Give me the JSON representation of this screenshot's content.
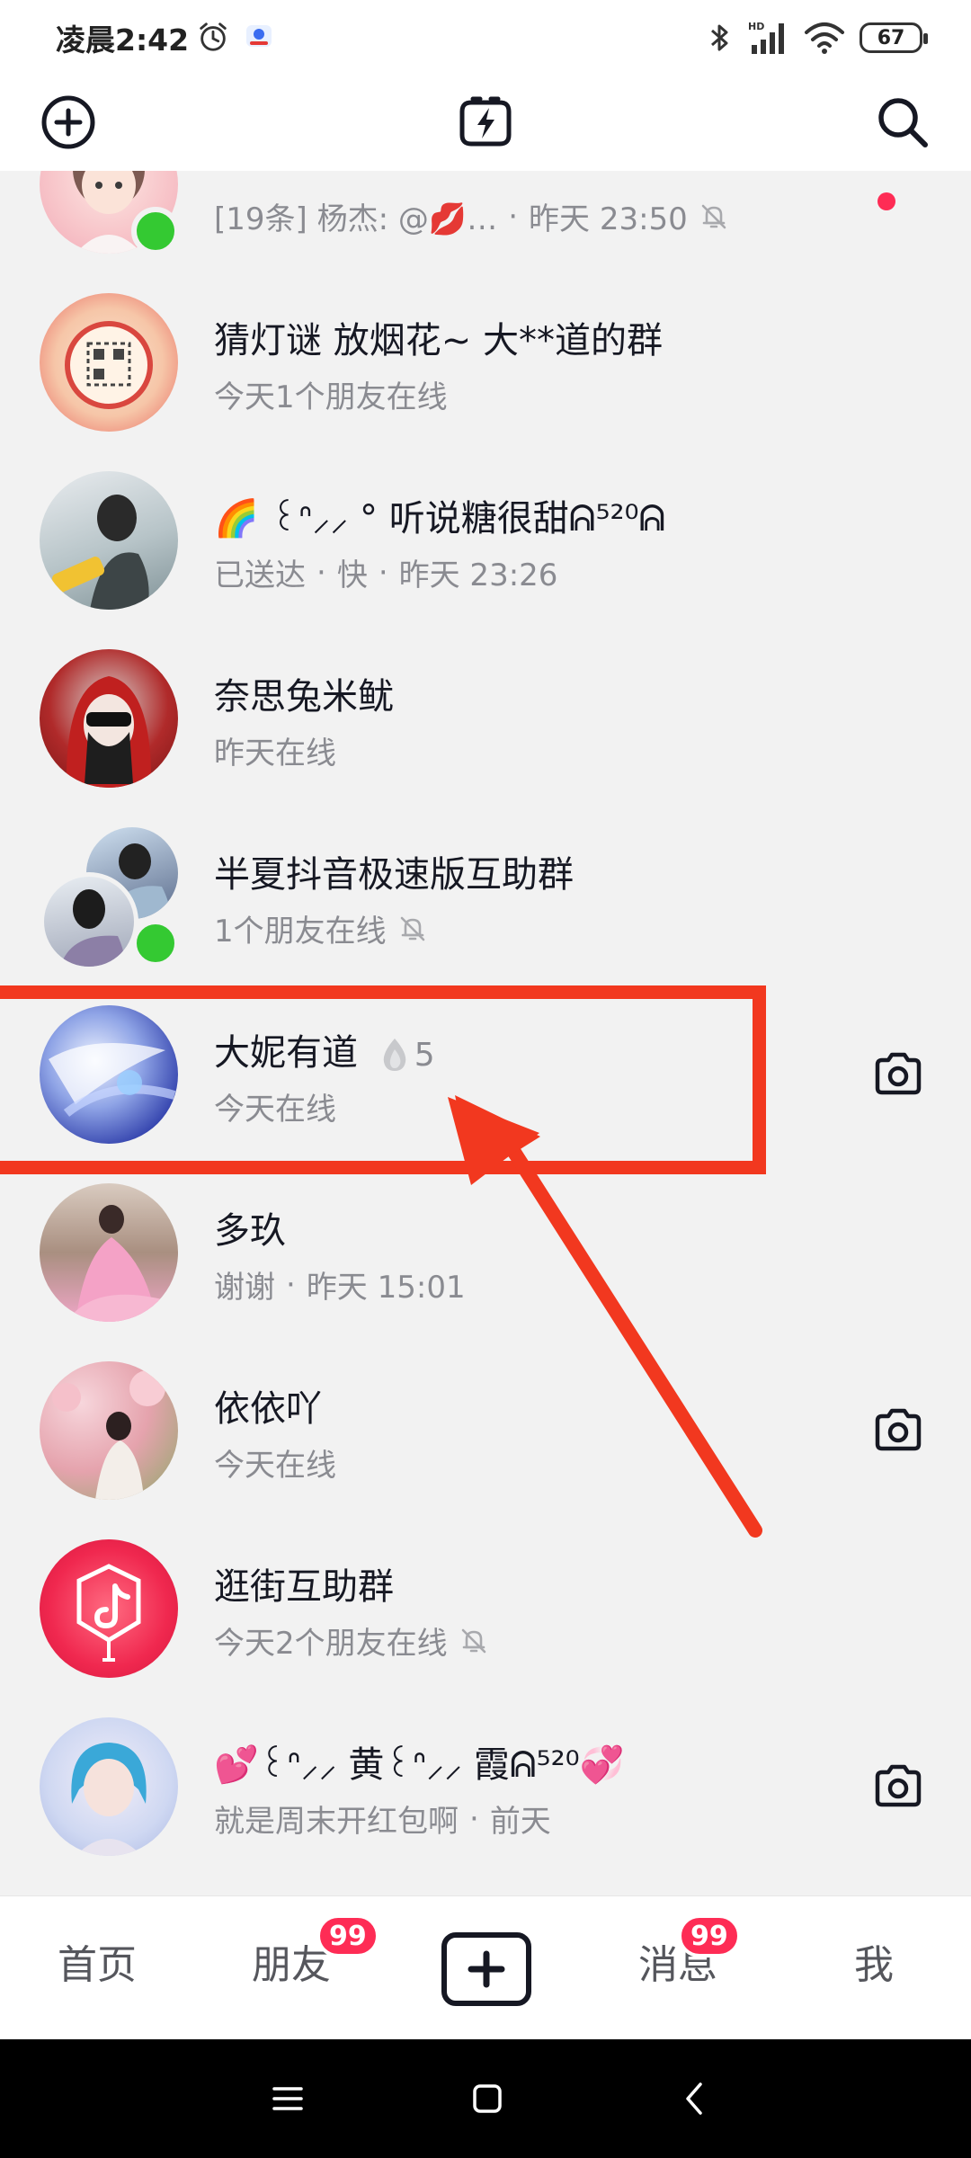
{
  "status_bar": {
    "time": "凌晨2:42",
    "battery": "67",
    "signal_label": "HD"
  },
  "top_nav": {
    "add_icon": "plus-circle-icon",
    "center_icon": "flash-chat-icon",
    "search_icon": "search-icon"
  },
  "chats": [
    {
      "name": "",
      "subtitle": "[19条] 杨杰: @💋…",
      "time": "昨天 23:50",
      "muted": true,
      "online": true,
      "unread_dot": true
    },
    {
      "name": "猜灯谜 放烟花~ 大**道的群",
      "subtitle": "今天1个朋友在线"
    },
    {
      "name": "🌈 ꒰ᐢ⸝⸝ ° 听说糖很甜ᕱ⁵²⁰ᕱ",
      "subtitle": "已送达",
      "subtitle2": "快",
      "time": "昨天 23:26"
    },
    {
      "name": "奈思兔米鱿",
      "subtitle": "昨天在线"
    },
    {
      "name": "半夏抖音极速版互助群",
      "subtitle": "1个朋友在线",
      "muted": true,
      "online": true
    },
    {
      "name": "大妮有道",
      "spark_count": "5",
      "subtitle": "今天在线",
      "camera": true
    },
    {
      "name": "多玖",
      "subtitle": "谢谢",
      "time": "昨天 15:01"
    },
    {
      "name": "依依吖",
      "subtitle": "今天在线",
      "camera": true
    },
    {
      "name": "逛街互助群",
      "subtitle": "今天2个朋友在线",
      "muted": true
    },
    {
      "name": "💕꒰ᐢ⸝⸝ 黄꒰ᐢ⸝⸝ 霞ᕱ⁵²⁰💞",
      "subtitle": "就是周末开红包啊",
      "time": "前天",
      "camera": true
    }
  ],
  "tab_bar": {
    "home": "首页",
    "friends": "朋友",
    "friends_badge": "99",
    "messages": "消息",
    "messages_badge": "99",
    "me": "我"
  },
  "colors": {
    "accent": "#fe2c55",
    "annotation": "#f2381f",
    "online": "#34c932"
  }
}
